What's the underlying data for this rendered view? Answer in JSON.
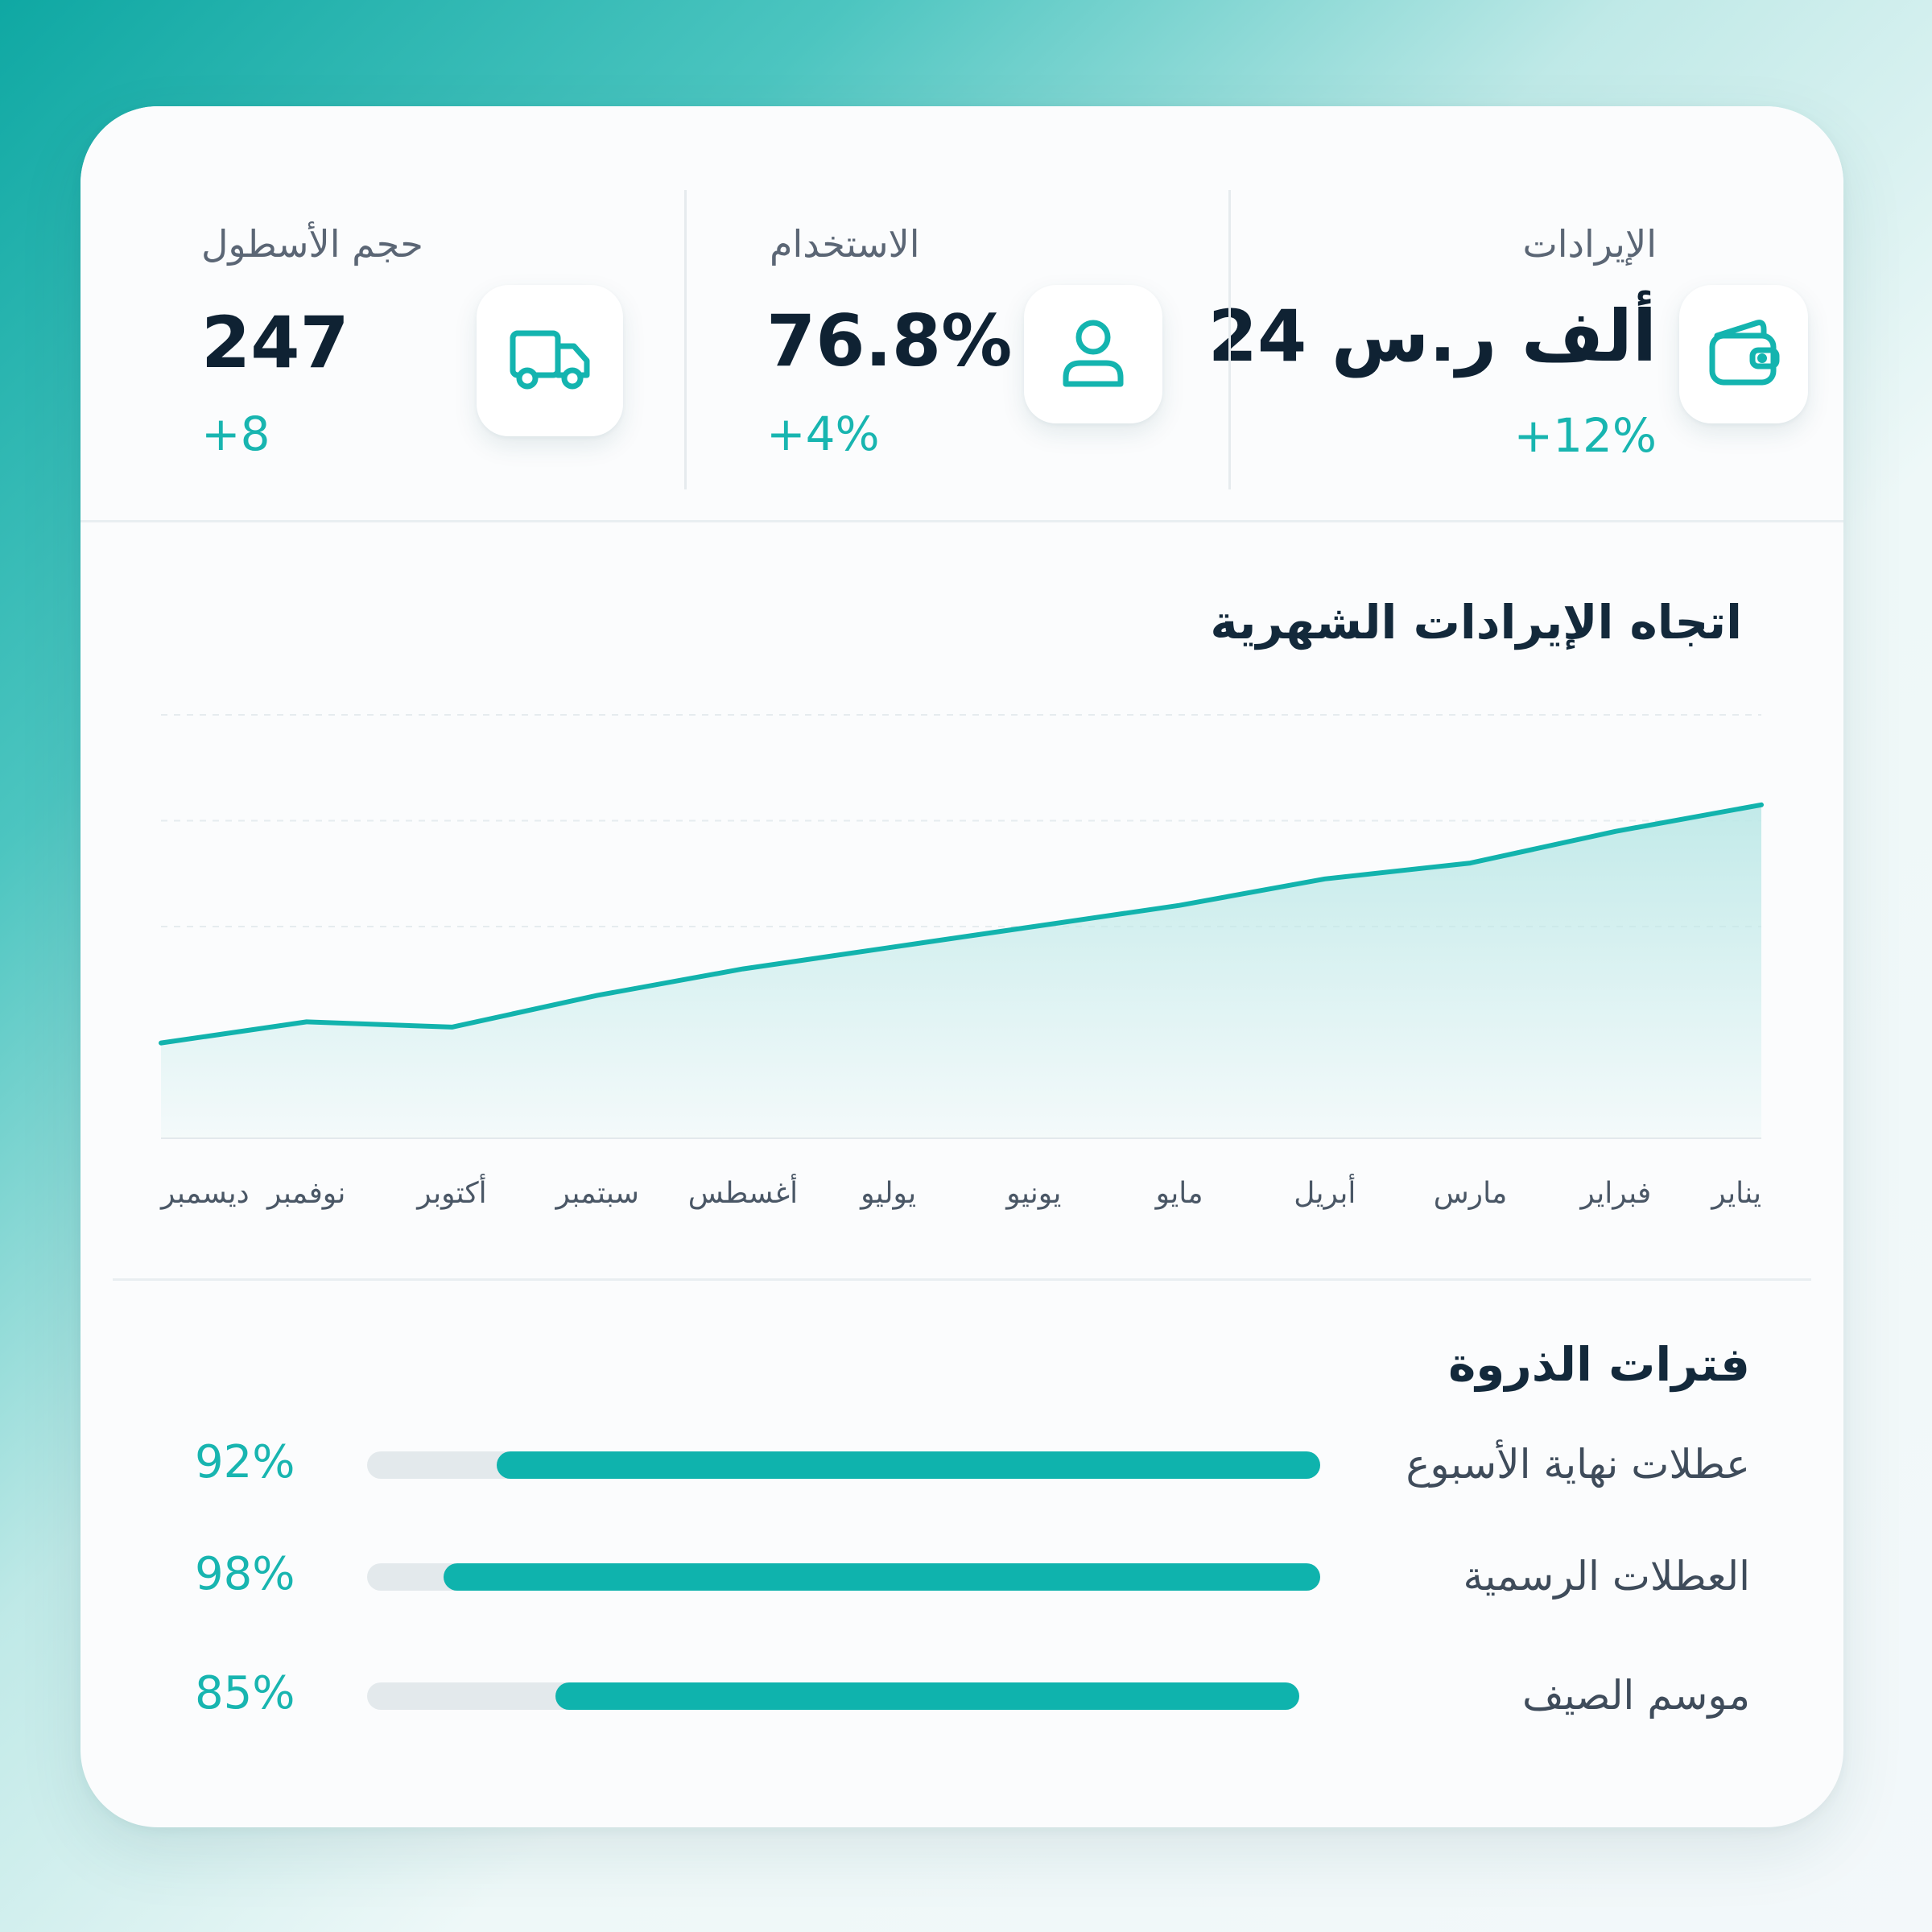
{
  "kpis": [
    {
      "label": "الإيرادات",
      "value": "24 ألف ر.س",
      "change": "+12%",
      "icon": "wallet-icon"
    },
    {
      "label": "الاستخدام",
      "value": "76.8%",
      "change": "+4%",
      "icon": "user-icon"
    },
    {
      "label": "حجم الأسطول",
      "value": "247",
      "change": "+8",
      "icon": "truck-icon"
    }
  ],
  "chart_data": {
    "type": "area",
    "title": "اتجاه الإيرادات الشهرية",
    "categories": [
      "يناير",
      "فبراير",
      "مارس",
      "أبريل",
      "مايو",
      "يونيو",
      "يوليو",
      "أغسطس",
      "سبتمبر",
      "أكتوبر",
      "نوفمبر",
      "ديسمبر"
    ],
    "values": [
      6.3,
      5.8,
      5.2,
      4.9,
      4.4,
      4.0,
      3.6,
      3.2,
      2.7,
      2.1,
      2.2,
      1.8
    ],
    "ylim": [
      0,
      8
    ],
    "x_direction": "right-to-left",
    "grid": true,
    "colors": {
      "line": "#12b3ad",
      "fill": "#bfe9e8"
    }
  },
  "peaks": {
    "title": "فترات الذروة",
    "items": [
      {
        "label": "عطلات نهاية الأسبوع",
        "percent": "92%",
        "value": 0.92
      },
      {
        "label": "العطلات الرسمية",
        "percent": "98%",
        "value": 0.98
      },
      {
        "label": "موسم الصيف",
        "percent": "85%",
        "value": 0.85
      }
    ]
  },
  "colors": {
    "accent": "#18b5b0",
    "text_dark": "#0f2233",
    "track": "#e3e9ec"
  }
}
